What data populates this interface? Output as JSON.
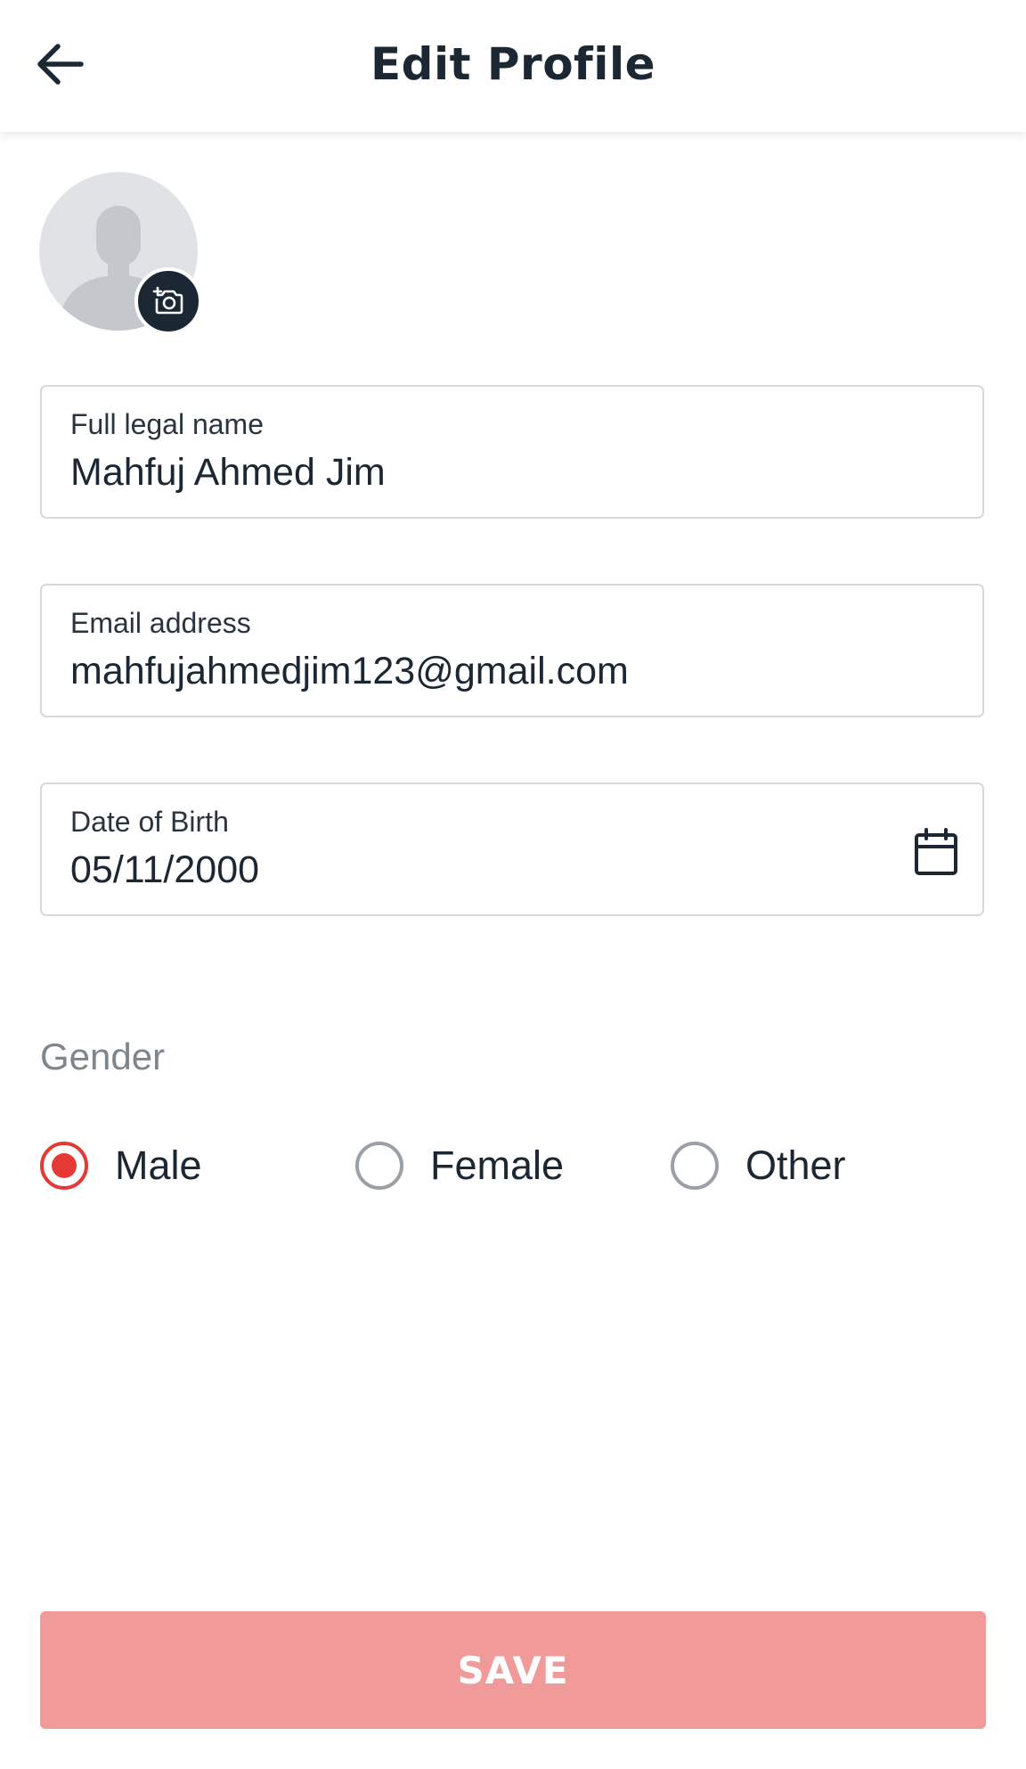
{
  "header": {
    "title": "Edit Profile",
    "back_icon": "arrow-left-icon"
  },
  "profile": {
    "avatar_icon": "default-user-silhouette",
    "camera_icon": "add-photo-camera-icon"
  },
  "form": {
    "full_name": {
      "label": "Full legal name",
      "value": "Mahfuj Ahmed Jim"
    },
    "email": {
      "label": "Email address",
      "value": "mahfujahmedjim123@gmail.com"
    },
    "dob": {
      "label": "Date of Birth",
      "value": "05/11/2000",
      "icon": "calendar-icon"
    },
    "gender": {
      "label": "Gender",
      "options": [
        "Male",
        "Female",
        "Other"
      ],
      "selected": "Male"
    }
  },
  "actions": {
    "save_label": "SAVE"
  },
  "colors": {
    "primary_text": "#1b2733",
    "accent": "#e53935",
    "save_disabled_bg": "#f09a9a",
    "field_border": "#d6d8db",
    "muted_label": "#7d858d"
  }
}
